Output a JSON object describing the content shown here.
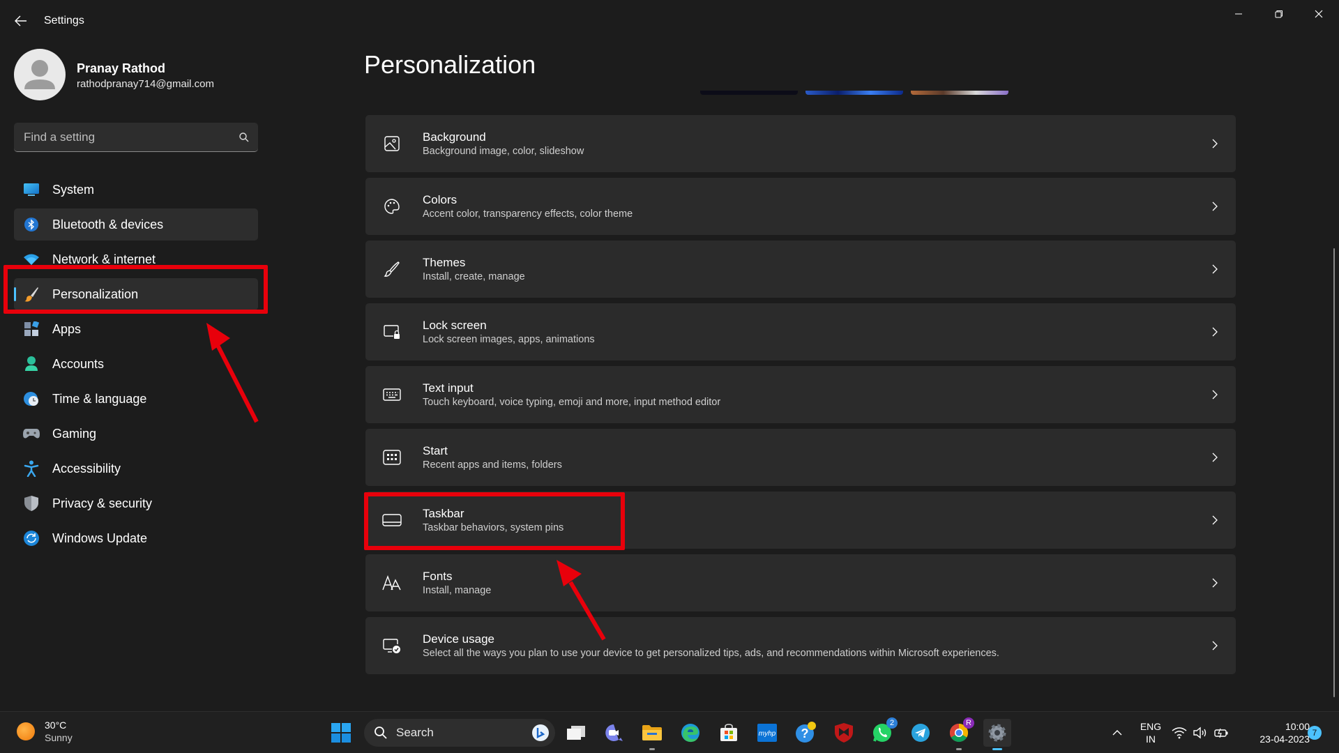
{
  "window": {
    "title": "Settings"
  },
  "profile": {
    "name": "Pranay Rathod",
    "email": "rathodpranay714@gmail.com"
  },
  "search": {
    "placeholder": "Find a setting"
  },
  "sidebar": {
    "items": [
      {
        "label": "System",
        "icon": "system-icon"
      },
      {
        "label": "Bluetooth & devices",
        "icon": "bluetooth-icon"
      },
      {
        "label": "Network & internet",
        "icon": "wifi-icon"
      },
      {
        "label": "Personalization",
        "icon": "brush-icon"
      },
      {
        "label": "Apps",
        "icon": "apps-icon"
      },
      {
        "label": "Accounts",
        "icon": "person-icon"
      },
      {
        "label": "Time & language",
        "icon": "globe-clock-icon"
      },
      {
        "label": "Gaming",
        "icon": "gamepad-icon"
      },
      {
        "label": "Accessibility",
        "icon": "accessibility-icon"
      },
      {
        "label": "Privacy & security",
        "icon": "shield-icon"
      },
      {
        "label": "Windows Update",
        "icon": "update-icon"
      }
    ]
  },
  "main": {
    "title": "Personalization",
    "cards": [
      {
        "title": "Background",
        "subtitle": "Background image, color, slideshow",
        "icon": "image-icon"
      },
      {
        "title": "Colors",
        "subtitle": "Accent color, transparency effects, color theme",
        "icon": "palette-icon"
      },
      {
        "title": "Themes",
        "subtitle": "Install, create, manage",
        "icon": "brush-icon"
      },
      {
        "title": "Lock screen",
        "subtitle": "Lock screen images, apps, animations",
        "icon": "lock-screen-icon"
      },
      {
        "title": "Text input",
        "subtitle": "Touch keyboard, voice typing, emoji and more, input method editor",
        "icon": "keyboard-icon"
      },
      {
        "title": "Start",
        "subtitle": "Recent apps and items, folders",
        "icon": "start-icon"
      },
      {
        "title": "Taskbar",
        "subtitle": "Taskbar behaviors, system pins",
        "icon": "taskbar-icon"
      },
      {
        "title": "Fonts",
        "subtitle": "Install, manage",
        "icon": "fonts-icon"
      },
      {
        "title": "Device usage",
        "subtitle": "Select all the ways you plan to use your device to get personalized tips, ads, and recommendations within Microsoft experiences.",
        "icon": "device-usage-icon"
      }
    ]
  },
  "taskbar": {
    "weather": {
      "temp": "30°C",
      "desc": "Sunny"
    },
    "search_label": "Search",
    "badges": {
      "whatsapp": "2",
      "chrome": "R",
      "notifications": "7"
    },
    "tray": {
      "lang_top": "ENG",
      "lang_bottom": "IN",
      "time": "10:00",
      "date": "23-04-2023"
    }
  },
  "colors": {
    "accent": "#4cc2ff",
    "highlight": "#e8000b",
    "background": "#1c1c1c",
    "card": "#2b2b2b"
  }
}
